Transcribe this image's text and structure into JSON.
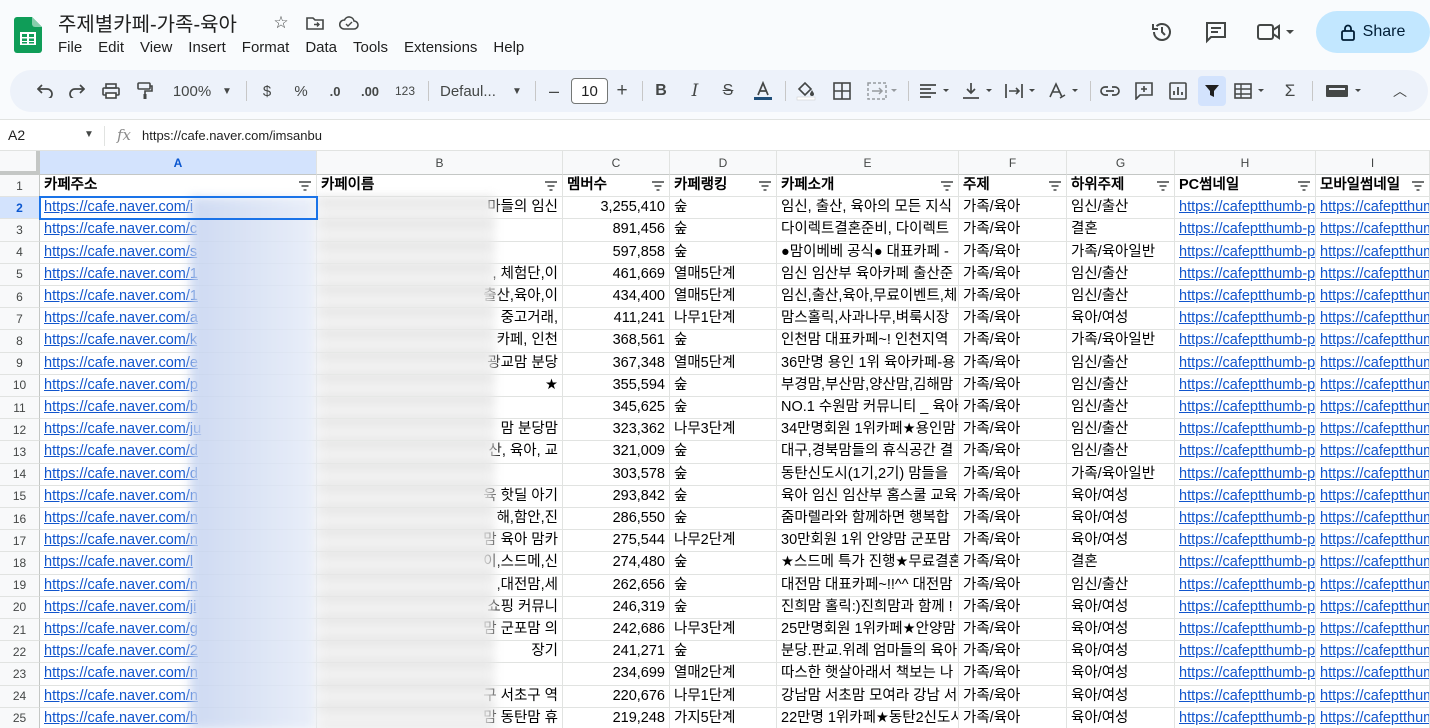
{
  "doc": {
    "title": "주제별카페-가족-육아"
  },
  "menu": [
    "File",
    "Edit",
    "View",
    "Insert",
    "Format",
    "Data",
    "Tools",
    "Extensions",
    "Help"
  ],
  "share_label": "Share",
  "toolbar": {
    "zoom": "100%",
    "currency": "$",
    "percent": "%",
    "dec_dec": ".0",
    "dec_inc": ".00",
    "more_formats": "123",
    "font": "Defaul...",
    "font_size": "10"
  },
  "formula": {
    "cell_ref": "A2",
    "fx": "fx",
    "content": "https://cafe.naver.com/imsanbu"
  },
  "columns": [
    "A",
    "B",
    "C",
    "D",
    "E",
    "F",
    "G",
    "H",
    "I"
  ],
  "header_row": [
    "카페주소",
    "카페이름",
    "멤버수",
    "카페랭킹",
    "카페소개",
    "주제",
    "하위주제",
    "PC썸네일",
    "모바일썸네일"
  ],
  "rows": [
    {
      "n": "2",
      "a": "https://cafe.naver.com/i",
      "b": "마들의 임신",
      "c": "3,255,410",
      "d": "숲",
      "e": "임신, 출산, 육아의 모든 지식",
      "f": "가족/육아",
      "g": "임신/출산",
      "h": "https://cafeptthumb-ph",
      "i": "https://cafeptthum"
    },
    {
      "n": "3",
      "a": "https://cafe.naver.com/c",
      "b": "",
      "c": "891,456",
      "d": "숲",
      "e": "다이렉트결혼준비, 다이렉트",
      "f": "가족/육아",
      "g": "결혼",
      "h": "https://cafeptthumb-ph",
      "i": "https://cafeptthum"
    },
    {
      "n": "4",
      "a": "https://cafe.naver.com/s",
      "b": "",
      "c": "597,858",
      "d": "숲",
      "e": "●맘이베베 공식● 대표카페 -",
      "f": "가족/육아",
      "g": "가족/육아일반",
      "h": "https://cafeptthumb-ph",
      "i": "https://cafeptthum"
    },
    {
      "n": "5",
      "a": "https://cafe.naver.com/1",
      "b": ", 체험단,이",
      "c": "461,669",
      "d": "열매5단계",
      "e": "임신 임산부 육아카페 출산준",
      "f": "가족/육아",
      "g": "임신/출산",
      "h": "https://cafeptthumb-ph",
      "i": "https://cafeptthum"
    },
    {
      "n": "6",
      "a": "https://cafe.naver.com/1",
      "b": "출산,육아,이",
      "c": "434,400",
      "d": "열매5단계",
      "e": "임신,출산,육아,무료이벤트,체",
      "f": "가족/육아",
      "g": "임신/출산",
      "h": "https://cafeptthumb-ph",
      "i": "https://cafeptthum"
    },
    {
      "n": "7",
      "a": "https://cafe.naver.com/a",
      "b": "중고거래,",
      "c": "411,241",
      "d": "나무1단계",
      "e": "맘스홀릭,사과나무,벼룩시장",
      "f": "가족/육아",
      "g": "육아/여성",
      "h": "https://cafeptthumb-ph",
      "i": "https://cafeptthum"
    },
    {
      "n": "8",
      "a": "https://cafe.naver.com/k",
      "b": "카페, 인천",
      "c": "368,561",
      "d": "숲",
      "e": "인천맘 대표카페~! 인천지역",
      "f": "가족/육아",
      "g": "가족/육아일반",
      "h": "https://cafeptthumb-ph",
      "i": "https://cafeptthum"
    },
    {
      "n": "9",
      "a": "https://cafe.naver.com/e",
      "b": "광교맘 분당",
      "c": "367,348",
      "d": "열매5단계",
      "e": "36만명 용인 1위 육아카페-용",
      "f": "가족/육아",
      "g": "임신/출산",
      "h": "https://cafeptthumb-ph",
      "i": "https://cafeptthum"
    },
    {
      "n": "10",
      "a": "https://cafe.naver.com/p",
      "b": "★",
      "c": "355,594",
      "d": "숲",
      "e": "부경맘,부산맘,양산맘,김해맘",
      "f": "가족/육아",
      "g": "임신/출산",
      "h": "https://cafeptthumb-ph",
      "i": "https://cafeptthum"
    },
    {
      "n": "11",
      "a": "https://cafe.naver.com/b",
      "b": "",
      "c": "345,625",
      "d": "숲",
      "e": "NO.1 수원맘 커뮤니티 _ 육아",
      "f": "가족/육아",
      "g": "임신/출산",
      "h": "https://cafeptthumb-ph",
      "i": "https://cafeptthum"
    },
    {
      "n": "12",
      "a": "https://cafe.naver.com/ju",
      "b": "맘 분당맘",
      "c": "323,362",
      "d": "나무3단계",
      "e": "34만명회원 1위카페★용인맘",
      "f": "가족/육아",
      "g": "임신/출산",
      "h": "https://cafeptthumb-ph",
      "i": "https://cafeptthum"
    },
    {
      "n": "13",
      "a": "https://cafe.naver.com/d",
      "b": "산, 육아, 교",
      "c": "321,009",
      "d": "숲",
      "e": "대구,경북맘들의 휴식공간 결",
      "f": "가족/육아",
      "g": "임신/출산",
      "h": "https://cafeptthumb-ph",
      "i": "https://cafeptthum"
    },
    {
      "n": "14",
      "a": "https://cafe.naver.com/d",
      "b": "",
      "c": "303,578",
      "d": "숲",
      "e": "동탄신도시(1기,2기) 맘들을",
      "f": "가족/육아",
      "g": "가족/육아일반",
      "h": "https://cafeptthumb-ph",
      "i": "https://cafeptthum"
    },
    {
      "n": "15",
      "a": "https://cafe.naver.com/n",
      "b": "육 핫딜 아기",
      "c": "293,842",
      "d": "숲",
      "e": "육아 임신 임산부 홈스쿨 교육",
      "f": "가족/육아",
      "g": "육아/여성",
      "h": "https://cafeptthumb-ph",
      "i": "https://cafeptthum"
    },
    {
      "n": "16",
      "a": "https://cafe.naver.com/n",
      "b": "해,함안,진",
      "c": "286,550",
      "d": "숲",
      "e": "줌마렐라와 함께하면 행복합",
      "f": "가족/육아",
      "g": "육아/여성",
      "h": "https://cafeptthumb-ph",
      "i": "https://cafeptthum"
    },
    {
      "n": "17",
      "a": "https://cafe.naver.com/n",
      "b": "맘 육아 맘카",
      "c": "275,544",
      "d": "나무2단계",
      "e": "30만회원 1위 안양맘 군포맘",
      "f": "가족/육아",
      "g": "육아/여성",
      "h": "https://cafeptthumb-ph",
      "i": "https://cafeptthum"
    },
    {
      "n": "18",
      "a": "https://cafe.naver.com/l",
      "b": "이,스드메,신",
      "c": "274,480",
      "d": "숲",
      "e": "★스드메 특가 진행★무료결혼",
      "f": "가족/육아",
      "g": "결혼",
      "h": "https://cafeptthumb-ph",
      "i": "https://cafeptthum"
    },
    {
      "n": "19",
      "a": "https://cafe.naver.com/n",
      "b": ",대전맘,세",
      "c": "262,656",
      "d": "숲",
      "e": "대전맘 대표카페~!!^^ 대전맘",
      "f": "가족/육아",
      "g": "임신/출산",
      "h": "https://cafeptthumb-ph",
      "i": "https://cafeptthum"
    },
    {
      "n": "20",
      "a": "https://cafe.naver.com/ji",
      "b": "쇼핑 커뮤니",
      "c": "246,319",
      "d": "숲",
      "e": "진희맘 홀릭:)진희맘과 함께 !",
      "f": "가족/육아",
      "g": "육아/여성",
      "h": "https://cafeptthumb-ph",
      "i": "https://cafeptthum"
    },
    {
      "n": "21",
      "a": "https://cafe.naver.com/g",
      "b": "맘 군포맘 의",
      "c": "242,686",
      "d": "나무3단계",
      "e": "25만명회원 1위카페★안양맘",
      "f": "가족/육아",
      "g": "육아/여성",
      "h": "https://cafeptthumb-ph",
      "i": "https://cafeptthum"
    },
    {
      "n": "22",
      "a": "https://cafe.naver.com/2",
      "b": "장기",
      "c": "241,271",
      "d": "숲",
      "e": "분당.판교.위례 엄마들의 육아",
      "f": "가족/육아",
      "g": "육아/여성",
      "h": "https://cafeptthumb-ph",
      "i": "https://cafeptthum"
    },
    {
      "n": "23",
      "a": "https://cafe.naver.com/n",
      "b": "",
      "c": "234,699",
      "d": "열매2단계",
      "e": "따스한 햇살아래서 책보는 나",
      "f": "가족/육아",
      "g": "육아/여성",
      "h": "https://cafeptthumb-ph",
      "i": "https://cafeptthum"
    },
    {
      "n": "24",
      "a": "https://cafe.naver.com/n",
      "b": "구 서초구 역",
      "c": "220,676",
      "d": "나무1단계",
      "e": "강남맘 서초맘 모여라 강남 서",
      "f": "가족/육아",
      "g": "육아/여성",
      "h": "https://cafeptthumb-ph",
      "i": "https://cafeptthum"
    },
    {
      "n": "25",
      "a": "https://cafe.naver.com/h",
      "b": "맘 동탄맘 휴",
      "c": "219,248",
      "d": "가지5단계",
      "e": "22만명 1위카페★동탄2신도시",
      "f": "가족/육아",
      "g": "육아/여성",
      "h": "https://cafeptthumb-ph",
      "i": "https://cafeptthum"
    }
  ]
}
